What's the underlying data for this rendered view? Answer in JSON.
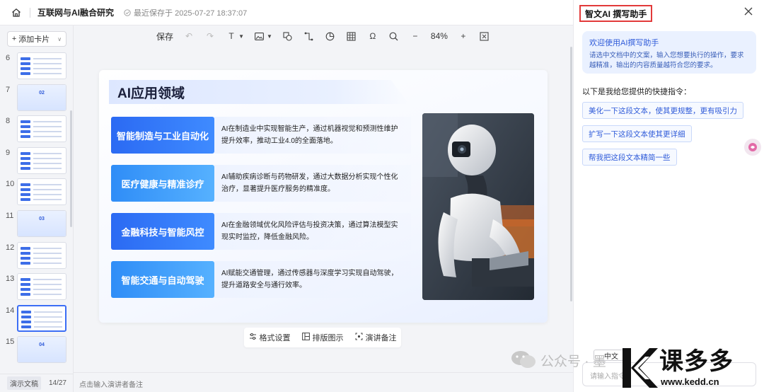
{
  "topbar": {
    "doc_title": "互联网与AI融合研究",
    "save_status": "最近保存于 2025-07-27 18:37:07"
  },
  "toolbar": {
    "save_label": "保存",
    "text_label": "T",
    "zoom": "84%"
  },
  "sidebar": {
    "add_card_label": "添加卡片",
    "thumbnails": [
      {
        "num": "6"
      },
      {
        "num": "7",
        "section": "02"
      },
      {
        "num": "8"
      },
      {
        "num": "9"
      },
      {
        "num": "10"
      },
      {
        "num": "11",
        "section": "03"
      },
      {
        "num": "12"
      },
      {
        "num": "13"
      },
      {
        "num": "14",
        "selected": true
      },
      {
        "num": "15",
        "section": "04"
      }
    ],
    "mode_label": "演示文稿",
    "page_counter": "14/27"
  },
  "slide": {
    "title": "AI应用领域",
    "rows": [
      {
        "tag": "智能制造与工业自动化",
        "desc": "AI在制造业中实现智能生产，通过机器视觉和预测性维护提升效率，推动工业4.0的全面落地。"
      },
      {
        "tag": "医疗健康与精准诊疗",
        "desc": "AI辅助疾病诊断与药物研发，通过大数据分析实现个性化治疗，显著提升医疗服务的精准度。"
      },
      {
        "tag": "金融科技与智能风控",
        "desc": "AI在金融领域优化风险评估与投资决策，通过算法模型实现实时监控，降低金融风险。"
      },
      {
        "tag": "智能交通与自动驾驶",
        "desc": "AI赋能交通管理，通过传感器与深度学习实现自动驾驶，提升道路安全与通行效率。"
      }
    ]
  },
  "slide_toolbar": {
    "format_label": "格式设置",
    "layout_label": "排版图示",
    "notes_label": "演讲备注"
  },
  "notes_placeholder": "点击输入演讲者备注",
  "panel": {
    "title": "智文AI 撰写助手",
    "welcome_heading": "欢迎使用AI撰写助手",
    "welcome_body": "请选中文档中的文案，输入您想要执行的操作，要求越精准，输出的内容质量越符合您的要求。",
    "quick_label": "以下是我给您提供的快捷指令：",
    "quick_commands": [
      "美化一下这段文本，使其更规整，更有吸引力",
      "扩写一下这段文本使其更详细",
      "帮我把这段文本精简一些"
    ],
    "language": "中文",
    "input_placeholder": "请输入指令"
  },
  "watermark": {
    "text": "公众号 · 墨",
    "brand_name": "课多多",
    "brand_url": "www.kedd.cn"
  },
  "colors": {
    "accent": "#3c6ef5",
    "tag_blue": "#2b6af3",
    "highlight_border": "#e23a3a"
  }
}
